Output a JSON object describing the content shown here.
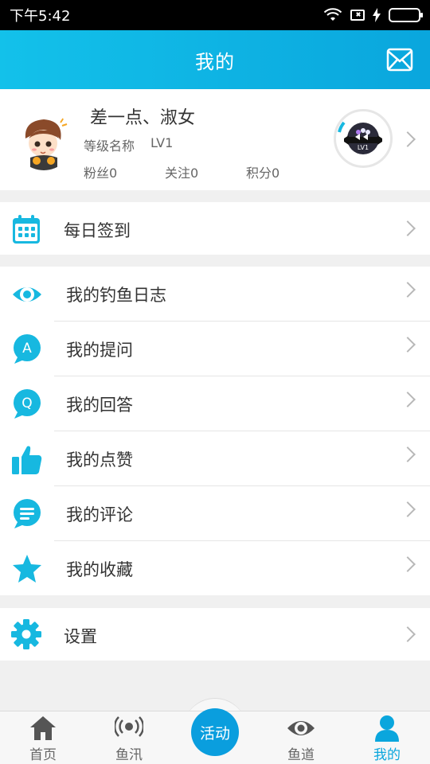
{
  "status_bar": {
    "time": "下午5:42",
    "icons": [
      "wifi-icon",
      "sim-icon",
      "charging-icon",
      "battery-icon"
    ]
  },
  "header": {
    "title": "我的",
    "mail_icon": "mail-icon"
  },
  "profile": {
    "username": "差一点、淑女",
    "level_name_label": "等级名称",
    "level_value": "LV1",
    "fans": "粉丝0",
    "following": "关注0",
    "points": "积分0",
    "badge_text": "LV1"
  },
  "sections": {
    "checkin": {
      "label": "每日签到",
      "icon": "calendar-icon"
    },
    "my_items": [
      {
        "label": "我的钓鱼日志",
        "icon": "eye-icon"
      },
      {
        "label": "我的提问",
        "icon": "question-bubble-icon"
      },
      {
        "label": "我的回答",
        "icon": "answer-bubble-icon"
      },
      {
        "label": "我的点赞",
        "icon": "thumbs-up-icon"
      },
      {
        "label": "我的评论",
        "icon": "comment-icon"
      },
      {
        "label": "我的收藏",
        "icon": "star-icon"
      }
    ],
    "settings": {
      "label": "设置",
      "icon": "gear-icon"
    }
  },
  "bottom_nav": {
    "items": [
      {
        "label": "首页",
        "icon": "home-icon"
      },
      {
        "label": "鱼汛",
        "icon": "broadcast-icon"
      },
      {
        "label": "鱼道",
        "icon": "eye-icon"
      },
      {
        "label": "我的",
        "icon": "user-icon"
      }
    ],
    "center_label": "活动",
    "active_index": 3
  },
  "colors": {
    "accent": "#0aa6dd",
    "icon": "#17b8e0",
    "text": "#333333",
    "subtext": "#666666",
    "background": "#f0f0f0"
  }
}
